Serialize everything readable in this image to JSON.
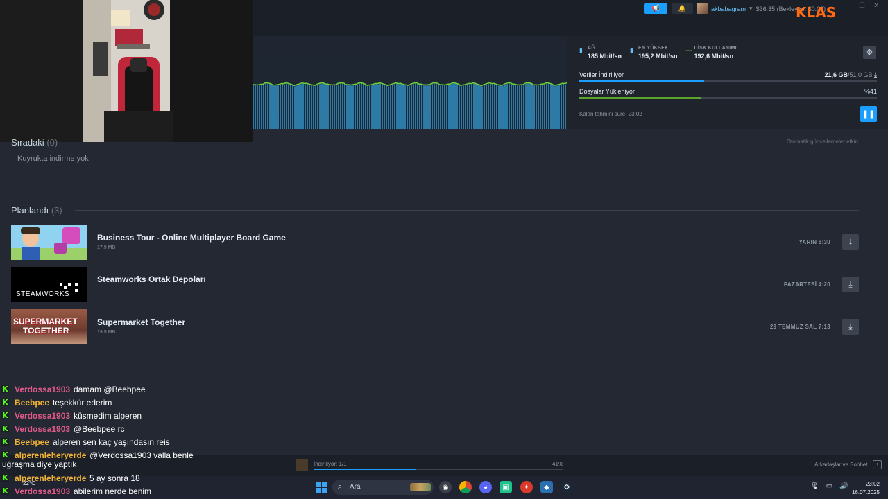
{
  "topbar": {
    "username": "akbabagram",
    "wallet": "$36.35 (Bekleyen: $0.03)",
    "brand": "KLAS"
  },
  "downloads": {
    "stats": [
      {
        "label": "AĞ",
        "value": "185 Mbit/sn",
        "color": "#66c0f4"
      },
      {
        "label": "EN YÜKSEK",
        "value": "195,2 Mbit/sn",
        "color": "#66c0f4"
      },
      {
        "label": "DİSK KULLANIMI",
        "value": "192,6 Mbit/sn",
        "color": "#5ba32b"
      }
    ],
    "downloading": {
      "label": "Veriler İndiriliyor",
      "value": "21,6 GB",
      "total": "/51,0 GB",
      "fraction": 0.42,
      "color": "#1a9fff"
    },
    "installing": {
      "label": "Dosyalar Yükleniyor",
      "value": "%41",
      "fraction": 0.41,
      "color": "#5ba32b"
    },
    "eta": "Kalan tahmini süre: 23:02"
  },
  "queue": {
    "title": "Sıradaki",
    "count": "(0)",
    "empty_text": "Kuyrukta indirme yok",
    "auto_updates": "Otomatik güncellemeler etkin"
  },
  "scheduled": {
    "title": "Planlandı",
    "count": "(3)",
    "items": [
      {
        "title": "Business Tour - Online Multiplayer Board Game",
        "size": "17.9 MB",
        "time": "YARIN 6:30"
      },
      {
        "title": "Steamworks Ortak Depoları",
        "size": "",
        "time": "PAZARTESİ 4:20"
      },
      {
        "title": "Supermarket Together",
        "size": "19.5 MB",
        "time": "29 TEMMUZ SAL 7:13"
      }
    ]
  },
  "thumbs": {
    "steamworks": "STEAMWORKS",
    "supermarket_1": "SUPERMARKET",
    "supermarket_2": "TOGETHER"
  },
  "chat": [
    {
      "user": "Verdossa1903",
      "msg": "damam @Beebpee",
      "color": "#e05a8a"
    },
    {
      "user": "Beebpee",
      "msg": "teşekkür ederim",
      "color": "#f0b232"
    },
    {
      "user": "Verdossa1903",
      "msg": "küsmedim alperen",
      "color": "#e05a8a"
    },
    {
      "user": "Verdossa1903",
      "msg": "@Beebpee rc",
      "color": "#e05a8a"
    },
    {
      "user": "Beebpee",
      "msg": "alperen sen kaç yaşındasın reis",
      "color": "#f0b232"
    },
    {
      "user": "alperenleheryerde",
      "msg": "@Verdossa1903 valla benle",
      "msg2": "uğraşma diye yaptık",
      "color": "#f0b232"
    },
    {
      "user": "alperenleheryerde",
      "msg": "5 ay sonra 18",
      "color": "#f0b232"
    },
    {
      "user": "Verdossa1903",
      "msg": "abilerim nerde benim",
      "color": "#e05a8a"
    }
  ],
  "statusbar": {
    "label": "İndiriliyor: 1/1",
    "percent": "41%",
    "fraction": 0.41,
    "friends": "Arkadaşlar ve Sohbet"
  },
  "taskbar": {
    "weather": "22°C",
    "search_placeholder": "Ara",
    "time": "23:02",
    "date": "16.07.2025"
  }
}
